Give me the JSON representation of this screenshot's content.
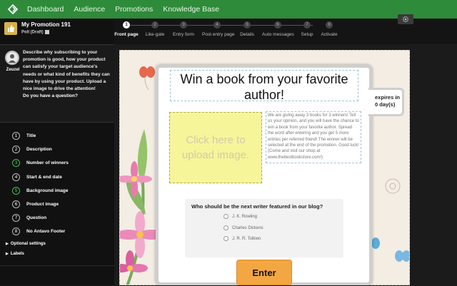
{
  "nav": {
    "items": [
      "Dashboard",
      "Audience",
      "Promotions",
      "Knowledge Base"
    ]
  },
  "promotion": {
    "title": "My Promotion 191",
    "status": "Poll (Draft)"
  },
  "help": {
    "name": "Zeuzel",
    "text": "Describe why subscribing to your promotion is good, how your product can satisfy your target audience's needs or what kind of benefits they can have by using your product. Upload a nice image to drive the attention!",
    "question": "Do you have a question?"
  },
  "steps": [
    {
      "num": "1",
      "label": "Title",
      "done": false
    },
    {
      "num": "2",
      "label": "Description",
      "done": false
    },
    {
      "num": "3",
      "label": "Number of winners",
      "done": true
    },
    {
      "num": "4",
      "label": "Start & end date",
      "done": false
    },
    {
      "num": "5",
      "label": "Background image",
      "done": true
    },
    {
      "num": "6",
      "label": "Product image",
      "done": false
    },
    {
      "num": "7",
      "label": "Question",
      "done": false
    },
    {
      "num": "8",
      "label": "No Antavo Footer",
      "done": false
    }
  ],
  "sidebar_links": {
    "optional": "Optional settings",
    "labels": "Labels"
  },
  "wizard": [
    {
      "num": "1",
      "label": "Front page",
      "active": true
    },
    {
      "num": "2",
      "label": "Like-gate",
      "active": false
    },
    {
      "num": "3",
      "label": "Entry form",
      "active": false
    },
    {
      "num": "4",
      "label": "Post entry page",
      "active": false
    },
    {
      "num": "5",
      "label": "Details",
      "active": false
    },
    {
      "num": "6",
      "label": "Auto messages",
      "active": false
    },
    {
      "num": "7",
      "label": "Setup",
      "active": false
    },
    {
      "num": "8",
      "label": "Activate",
      "active": false
    }
  ],
  "card": {
    "title": "Win a book from your favorite author!",
    "upload_text": "Click here to upload image.",
    "description": "We are giving away 3 books for 3 winners! Tell us your opinion, and you will have the chance to win a book from your favorite author. Spread the word after entering and you get 5 more entries per referred friend! The winner will be selected at the end of the promotion. Good luck! (Come and visit our shop at www.thebestbookstore.com!)",
    "expires": "expires in 0 day(s)",
    "question": "Who should be the next writer featured in our blog?",
    "options": [
      "J. K. Rowling",
      "Charles Dickens",
      "J. R. R. Tolkien"
    ],
    "enter": "Enter"
  },
  "colors": {
    "nav_green": "#2e8b3a",
    "enter_orange": "#f3a742",
    "upload_yellow": "#f7f59a",
    "step_done": "#3fbf4f"
  }
}
